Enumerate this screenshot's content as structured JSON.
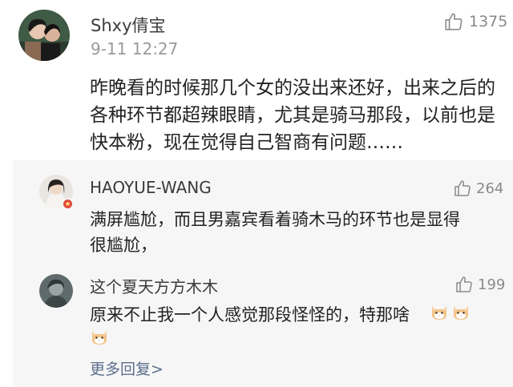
{
  "main_comment": {
    "author": "Shxy倩宝",
    "time": "9-11 12:27",
    "likes": "1375",
    "lines": [
      "昨晚看的时候那几个女的没出来还好，出来之后的",
      "各种环节都超辣眼睛，尤其是骑马那段，以前也是",
      "快本粉，现在觉得自己智商有问题……"
    ]
  },
  "replies": [
    {
      "author": "HAOYUE-WANG",
      "likes": "264",
      "lines": [
        "满屏尴尬，而且男嘉宾看着骑木马的环节也是显得",
        "很尴尬，"
      ]
    },
    {
      "author": "这个夏天方方木木",
      "likes": "199",
      "lines": [
        "原来不止我一个人感觉那段怪怪的，特那啥"
      ],
      "emoji": "cat-face-emoji"
    }
  ],
  "more_replies": "更多回复>",
  "icons": {
    "like": "thumbs-up-icon",
    "badge": "verified-badge-icon"
  },
  "colors": {
    "panel_bg": "#f6f6f6",
    "link": "#5b6e8c",
    "muted": "#8a8a8a"
  }
}
